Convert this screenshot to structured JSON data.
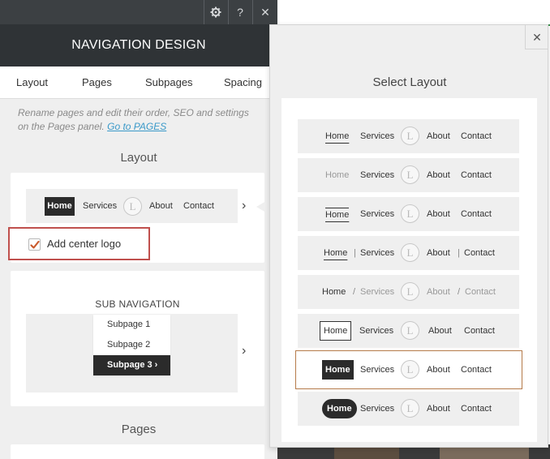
{
  "toolbar": {
    "help_label": "?",
    "close_label": "✕"
  },
  "panel": {
    "title": "NAVIGATION DESIGN",
    "tabs": [
      {
        "label": "Layout"
      },
      {
        "label": "Pages"
      },
      {
        "label": "Subpages"
      },
      {
        "label": "Spacing"
      }
    ],
    "info_text": "Rename pages and edit their order, SEO and settings on the Pages panel.",
    "info_link": "Go to PAGES",
    "layout_title": "Layout",
    "preview": {
      "items": [
        "Home",
        "Services",
        "L",
        "About",
        "Contact"
      ],
      "arrow": "›"
    },
    "checkbox": {
      "label": "Add center logo",
      "checked": true
    },
    "subnav": {
      "title": "SUB NAVIGATION",
      "items": [
        "Subpage 1",
        "Subpage 2",
        "Subpage 3 ›"
      ],
      "arrow": "›"
    },
    "pages_title": "Pages"
  },
  "popup": {
    "title": "Select Layout",
    "close_label": "✕",
    "logo_letter": "L",
    "options": [
      {
        "home": "Home",
        "items": [
          "Services",
          "About",
          "Contact"
        ],
        "separator": ""
      },
      {
        "home": "Home",
        "items": [
          "Services",
          "About",
          "Contact"
        ],
        "separator": ""
      },
      {
        "home": "Home",
        "items": [
          "Services",
          "About",
          "Contact"
        ],
        "separator": ""
      },
      {
        "home": "Home",
        "items": [
          "Services",
          "About",
          "Contact"
        ],
        "separator": "|"
      },
      {
        "home": "Home",
        "items": [
          "Services",
          "About",
          "Contact"
        ],
        "separator": "/"
      },
      {
        "home": "Home",
        "items": [
          "Services",
          "About",
          "Contact"
        ],
        "separator": ""
      },
      {
        "home": "Home",
        "items": [
          "Services",
          "About",
          "Contact"
        ],
        "separator": ""
      },
      {
        "home": "Home",
        "items": [
          "Services",
          "About",
          "Contact"
        ],
        "separator": ""
      }
    ],
    "selected_index": 6
  },
  "colors": {
    "dark_header": "#2f3336",
    "topbar": "#3c4043",
    "link": "#3a99c9",
    "highlight_border": "#c0504d",
    "selected_border": "#b57a49",
    "active_item": "#2b2b2b"
  }
}
